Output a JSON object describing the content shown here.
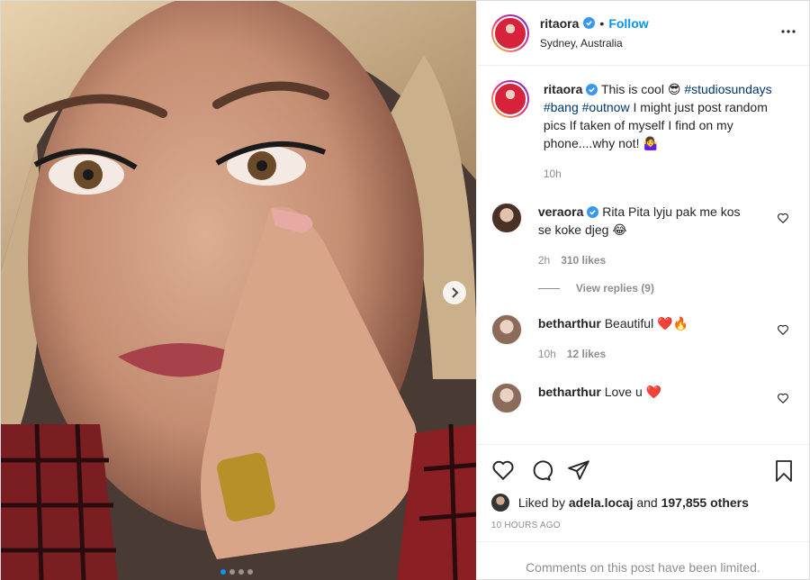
{
  "post": {
    "username": "ritaora",
    "follow_separator": "•",
    "follow_label": "Follow",
    "location": "Sydney, Australia",
    "more_icon": "more-horizontal-icon"
  },
  "caption": {
    "username": "ritaora",
    "text_before": "This is cool ",
    "emoji_1": "😎",
    "hashtags": "#studiosundays #bang #outnow",
    "text_after": " I might just post random pics If taken of myself I find on my phone....why not! ",
    "emoji_2": "🤷‍♀️",
    "time": "10h"
  },
  "comments": [
    {
      "username": "veraora",
      "text": "Rita Pita lyju pak me kos se koke djeg ",
      "emoji": "😂",
      "time": "2h",
      "likes": "310 likes",
      "view_replies": "View replies (9)"
    },
    {
      "username": "betharthur",
      "text": "Beautiful ",
      "emoji": "❤️🔥",
      "time": "10h",
      "likes": "12 likes"
    },
    {
      "username": "betharthur",
      "text": "Love u ",
      "emoji": "❤️"
    }
  ],
  "likes": {
    "prefix": "Liked by ",
    "user": "adela.locaj",
    "middle": " and ",
    "count": "197,855 others"
  },
  "timestamp": "10 HOURS AGO",
  "comments_limited": "Comments on this post have been limited.",
  "carousel": {
    "total": 4,
    "active_index": 0
  },
  "colors": {
    "accent": "#0095f6",
    "hashtag": "#00376b",
    "muted": "#8e8e8e"
  }
}
